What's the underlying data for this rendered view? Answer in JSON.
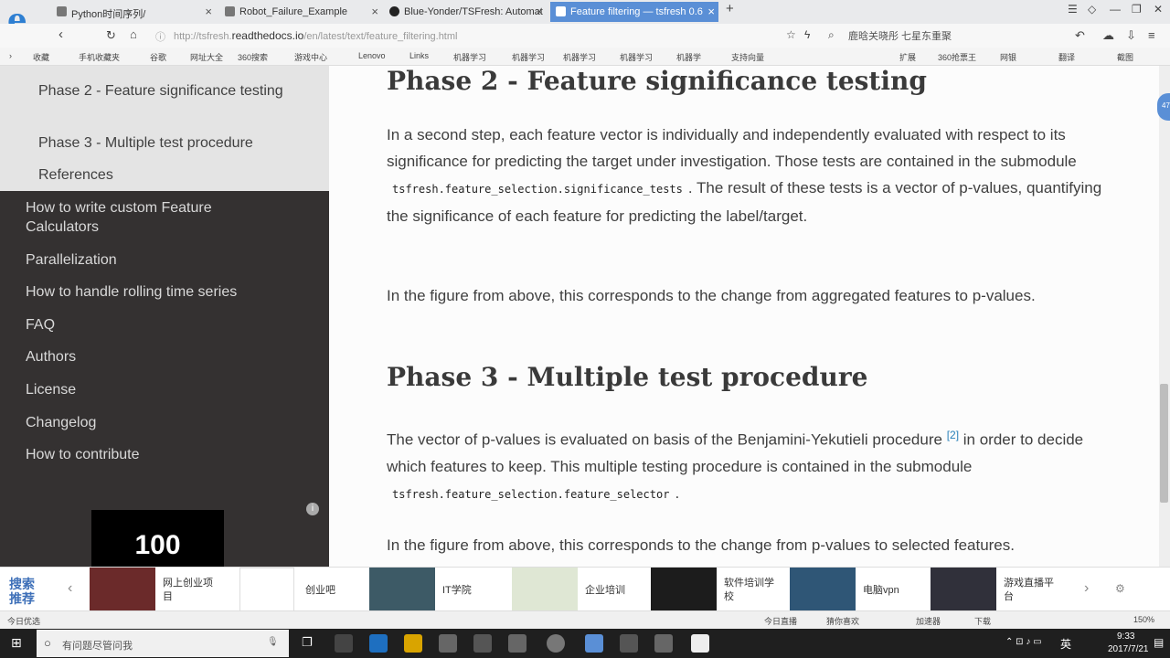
{
  "tabs": [
    {
      "title": "Python时间序列/"
    },
    {
      "title": "Robot_Failure_Example"
    },
    {
      "title": "Blue-Yonder/TSFresh: Automat"
    },
    {
      "title": "Feature filtering — tsfresh 0.6"
    }
  ],
  "address": {
    "url_prefix": "http://tsfresh.",
    "url_domain": "readthedocs.io",
    "url_path": "/en/latest/text/feature_filtering.html",
    "search_text": "鹿晗关晓彤 七星东重聚"
  },
  "bookmarks": [
    "收藏",
    "手机收藏夹",
    "谷歌",
    "网址大全",
    "360搜索",
    "游戏中心",
    "Lenovo",
    "Links",
    "机器学习",
    "机器学习",
    "机器学习",
    "机器学习",
    "机器学",
    "支持向量",
    "扩展",
    "360抢票王",
    "网银",
    "翻译",
    "截图"
  ],
  "sidebar": {
    "sub_items": [
      "Phase 2 - Feature significance testing",
      "Phase 3 - Multiple test procedure",
      "References"
    ],
    "items": [
      "How to write custom Feature Calculators",
      "Parallelization",
      "How to handle rolling time series",
      "FAQ",
      "Authors",
      "License",
      "Changelog",
      "How to contribute"
    ],
    "ad_text": "100"
  },
  "main": {
    "phase2_heading": "Phase 2 - Feature significance testing",
    "p1_a": "In a second step, each feature vector is individually and independently evaluated with respect to its significance for predicting the target under investigation. Those tests are contained in the submodule",
    "p1_code": "tsfresh.feature_selection.significance_tests",
    "p1_b": ". The result of these tests is a vector of p-values, quantifying the significance of each feature for predicting the label/target.",
    "p2": "In the figure from above, this corresponds to the change from aggregated features to p-values.",
    "phase3_heading": "Phase 3 - Multiple test procedure",
    "p3_a": "The vector of p-values is evaluated on basis of the Benjamini-Yekutieli procedure",
    "p3_ref": "[2]",
    "p3_b": "in order to decide which features to keep. This multiple testing procedure is contained in the submodule",
    "p3_code": "tsfresh.feature_selection.feature_selector",
    "p3_c": ".",
    "p4": "In the figure from above, this corresponds to the change from p-values to selected features."
  },
  "badge": "47",
  "adbar": {
    "label": "搜索推荐",
    "items": [
      "网上创业项目",
      "创业吧",
      "IT学院",
      "企业培训",
      "软件培训学校",
      "电脑vpn",
      "游戏直播平台"
    ]
  },
  "statusbar": {
    "left": "今日优选",
    "items": [
      "今日直播",
      "猜你喜欢",
      "加速器",
      "下载"
    ],
    "zoom": "150%"
  },
  "taskbar": {
    "search_placeholder": "有问题尽管问我",
    "time": "9:33",
    "date": "2017/7/21",
    "ime": "英"
  },
  "colors": {
    "sidebar_bg": "#343131",
    "tab_active": "#5a8fd6",
    "link": "#2980b9"
  }
}
